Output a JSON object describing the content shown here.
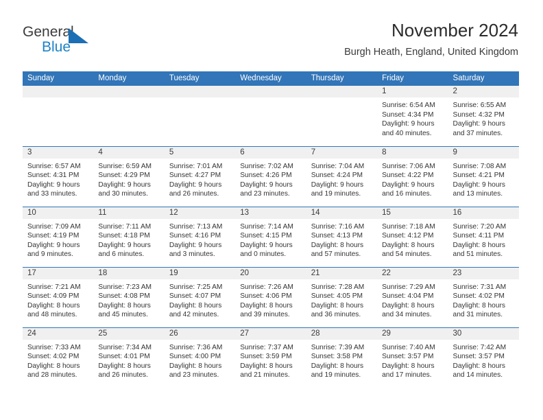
{
  "brand": {
    "word_general": "General",
    "word_blue": "Blue",
    "triangle_color": "#1c6fb5"
  },
  "header": {
    "title": "November 2024",
    "subtitle": "Burgh Heath, England, United Kingdom",
    "header_bg_color": "#3275b8",
    "daynum_band_color": "#f0f0f0"
  },
  "weekdays": [
    "Sunday",
    "Monday",
    "Tuesday",
    "Wednesday",
    "Thursday",
    "Friday",
    "Saturday"
  ],
  "weeks": [
    [
      {
        "day": "",
        "lines": []
      },
      {
        "day": "",
        "lines": []
      },
      {
        "day": "",
        "lines": []
      },
      {
        "day": "",
        "lines": []
      },
      {
        "day": "",
        "lines": []
      },
      {
        "day": "1",
        "lines": [
          "Sunrise: 6:54 AM",
          "Sunset: 4:34 PM",
          "Daylight: 9 hours",
          "and 40 minutes."
        ]
      },
      {
        "day": "2",
        "lines": [
          "Sunrise: 6:55 AM",
          "Sunset: 4:32 PM",
          "Daylight: 9 hours",
          "and 37 minutes."
        ]
      }
    ],
    [
      {
        "day": "3",
        "lines": [
          "Sunrise: 6:57 AM",
          "Sunset: 4:31 PM",
          "Daylight: 9 hours",
          "and 33 minutes."
        ]
      },
      {
        "day": "4",
        "lines": [
          "Sunrise: 6:59 AM",
          "Sunset: 4:29 PM",
          "Daylight: 9 hours",
          "and 30 minutes."
        ]
      },
      {
        "day": "5",
        "lines": [
          "Sunrise: 7:01 AM",
          "Sunset: 4:27 PM",
          "Daylight: 9 hours",
          "and 26 minutes."
        ]
      },
      {
        "day": "6",
        "lines": [
          "Sunrise: 7:02 AM",
          "Sunset: 4:26 PM",
          "Daylight: 9 hours",
          "and 23 minutes."
        ]
      },
      {
        "day": "7",
        "lines": [
          "Sunrise: 7:04 AM",
          "Sunset: 4:24 PM",
          "Daylight: 9 hours",
          "and 19 minutes."
        ]
      },
      {
        "day": "8",
        "lines": [
          "Sunrise: 7:06 AM",
          "Sunset: 4:22 PM",
          "Daylight: 9 hours",
          "and 16 minutes."
        ]
      },
      {
        "day": "9",
        "lines": [
          "Sunrise: 7:08 AM",
          "Sunset: 4:21 PM",
          "Daylight: 9 hours",
          "and 13 minutes."
        ]
      }
    ],
    [
      {
        "day": "10",
        "lines": [
          "Sunrise: 7:09 AM",
          "Sunset: 4:19 PM",
          "Daylight: 9 hours",
          "and 9 minutes."
        ]
      },
      {
        "day": "11",
        "lines": [
          "Sunrise: 7:11 AM",
          "Sunset: 4:18 PM",
          "Daylight: 9 hours",
          "and 6 minutes."
        ]
      },
      {
        "day": "12",
        "lines": [
          "Sunrise: 7:13 AM",
          "Sunset: 4:16 PM",
          "Daylight: 9 hours",
          "and 3 minutes."
        ]
      },
      {
        "day": "13",
        "lines": [
          "Sunrise: 7:14 AM",
          "Sunset: 4:15 PM",
          "Daylight: 9 hours",
          "and 0 minutes."
        ]
      },
      {
        "day": "14",
        "lines": [
          "Sunrise: 7:16 AM",
          "Sunset: 4:13 PM",
          "Daylight: 8 hours",
          "and 57 minutes."
        ]
      },
      {
        "day": "15",
        "lines": [
          "Sunrise: 7:18 AM",
          "Sunset: 4:12 PM",
          "Daylight: 8 hours",
          "and 54 minutes."
        ]
      },
      {
        "day": "16",
        "lines": [
          "Sunrise: 7:20 AM",
          "Sunset: 4:11 PM",
          "Daylight: 8 hours",
          "and 51 minutes."
        ]
      }
    ],
    [
      {
        "day": "17",
        "lines": [
          "Sunrise: 7:21 AM",
          "Sunset: 4:09 PM",
          "Daylight: 8 hours",
          "and 48 minutes."
        ]
      },
      {
        "day": "18",
        "lines": [
          "Sunrise: 7:23 AM",
          "Sunset: 4:08 PM",
          "Daylight: 8 hours",
          "and 45 minutes."
        ]
      },
      {
        "day": "19",
        "lines": [
          "Sunrise: 7:25 AM",
          "Sunset: 4:07 PM",
          "Daylight: 8 hours",
          "and 42 minutes."
        ]
      },
      {
        "day": "20",
        "lines": [
          "Sunrise: 7:26 AM",
          "Sunset: 4:06 PM",
          "Daylight: 8 hours",
          "and 39 minutes."
        ]
      },
      {
        "day": "21",
        "lines": [
          "Sunrise: 7:28 AM",
          "Sunset: 4:05 PM",
          "Daylight: 8 hours",
          "and 36 minutes."
        ]
      },
      {
        "day": "22",
        "lines": [
          "Sunrise: 7:29 AM",
          "Sunset: 4:04 PM",
          "Daylight: 8 hours",
          "and 34 minutes."
        ]
      },
      {
        "day": "23",
        "lines": [
          "Sunrise: 7:31 AM",
          "Sunset: 4:02 PM",
          "Daylight: 8 hours",
          "and 31 minutes."
        ]
      }
    ],
    [
      {
        "day": "24",
        "lines": [
          "Sunrise: 7:33 AM",
          "Sunset: 4:02 PM",
          "Daylight: 8 hours",
          "and 28 minutes."
        ]
      },
      {
        "day": "25",
        "lines": [
          "Sunrise: 7:34 AM",
          "Sunset: 4:01 PM",
          "Daylight: 8 hours",
          "and 26 minutes."
        ]
      },
      {
        "day": "26",
        "lines": [
          "Sunrise: 7:36 AM",
          "Sunset: 4:00 PM",
          "Daylight: 8 hours",
          "and 23 minutes."
        ]
      },
      {
        "day": "27",
        "lines": [
          "Sunrise: 7:37 AM",
          "Sunset: 3:59 PM",
          "Daylight: 8 hours",
          "and 21 minutes."
        ]
      },
      {
        "day": "28",
        "lines": [
          "Sunrise: 7:39 AM",
          "Sunset: 3:58 PM",
          "Daylight: 8 hours",
          "and 19 minutes."
        ]
      },
      {
        "day": "29",
        "lines": [
          "Sunrise: 7:40 AM",
          "Sunset: 3:57 PM",
          "Daylight: 8 hours",
          "and 17 minutes."
        ]
      },
      {
        "day": "30",
        "lines": [
          "Sunrise: 7:42 AM",
          "Sunset: 3:57 PM",
          "Daylight: 8 hours",
          "and 14 minutes."
        ]
      }
    ]
  ]
}
